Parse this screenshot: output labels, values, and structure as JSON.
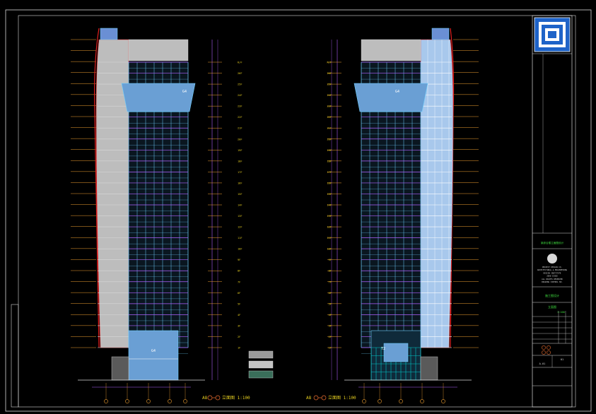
{
  "drawing": {
    "background": "#000000",
    "colors": {
      "frame": "#d8d8d8",
      "outline_red": "#e02020",
      "glass": "#6a9fd4",
      "glass_light": "#a8c8ec",
      "concrete": "#bdbdbd",
      "mullion": "#6fd0ff",
      "dim_orange": "#f0a030",
      "level_magenta": "#b060ff",
      "title_yellow": "#e8d020",
      "green": "#40e040",
      "cyan": "#00c8c8"
    },
    "left_elevation": {
      "caption_prefix": "A8",
      "caption": "立面图 1:100",
      "floor_count": 26,
      "podium_tag": "G4",
      "canopy_tag": "G4",
      "level_labels": [
        "R/F",
        "26F",
        "25F",
        "24F",
        "23F",
        "22F",
        "21F",
        "20F",
        "19F",
        "18F",
        "17F",
        "16F",
        "15F",
        "14F",
        "13F",
        "12F",
        "11F",
        "10F",
        "9F",
        "8F",
        "7F",
        "6F",
        "5F",
        "4F",
        "3F",
        "2F",
        "1F"
      ]
    },
    "right_elevation": {
      "caption_prefix": "A8",
      "caption": "立面图 1:100",
      "floor_count": 26,
      "podium_tag": "T2",
      "canopy_tag": "G4",
      "level_labels": [
        "R/F",
        "26F",
        "25F",
        "24F",
        "23F",
        "22F",
        "21F",
        "20F",
        "19F",
        "18F",
        "17F",
        "16F",
        "15F",
        "14F",
        "13F",
        "12F",
        "11F",
        "10F",
        "9F",
        "8F",
        "7F",
        "6F",
        "5F",
        "4F",
        "3F",
        "2F",
        "1F"
      ]
    },
    "title_block": {
      "project_label": "某综合楼立面图设计",
      "firm_lines": [
        "PROJECT DESIGN CO.",
        "ARCHITECTURAL & ENGINEERING",
        "DESIGN INSTITUTE",
        "2008 ISSUE",
        "ALL RIGHTS RESERVED",
        "DRAWING CONTROL NO."
      ],
      "stage": "施工图设计",
      "sheet_name": "立面图",
      "scale": "1:100",
      "sheet_no": "A-01",
      "revision": "01"
    }
  }
}
